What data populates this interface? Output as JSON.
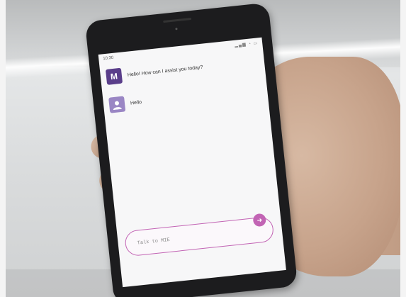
{
  "status_bar": {
    "time": "10:30",
    "icons": "wifi-icon signal-icon battery-icon"
  },
  "chat": {
    "messages": [
      {
        "sender": "bot",
        "avatar_letter": "M",
        "text": "Hello! How can I assist you today?"
      },
      {
        "sender": "user",
        "avatar_icon": "user-icon",
        "text": "Hello"
      }
    ]
  },
  "composer": {
    "placeholder": "Talk to MIE",
    "send_icon": "arrow-right-icon",
    "accent_color": "#c264b4"
  },
  "colors": {
    "bot_avatar": "#5a3e8a",
    "user_avatar": "#9a86c4"
  }
}
